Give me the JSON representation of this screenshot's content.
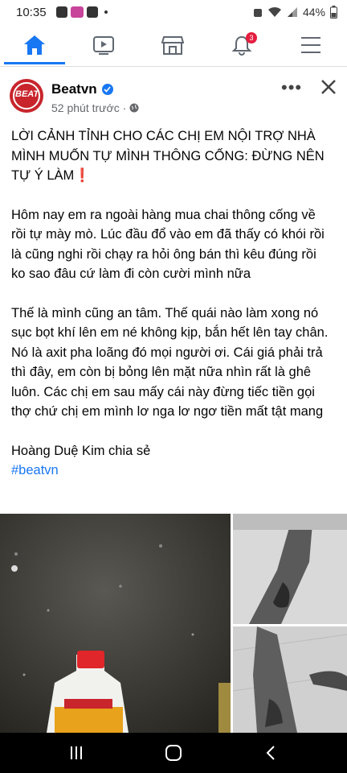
{
  "status_bar": {
    "time": "10:35",
    "battery": "44%"
  },
  "nav": {
    "tabs": [
      {
        "icon": "home-icon",
        "active": true
      },
      {
        "icon": "video-icon",
        "active": false
      },
      {
        "icon": "marketplace-icon",
        "active": false
      },
      {
        "icon": "notifications-icon",
        "active": false,
        "badge": "3"
      },
      {
        "icon": "menu-icon",
        "active": false
      }
    ],
    "accent": "#1877f2"
  },
  "post": {
    "page_name": "Beatvn",
    "avatar_text": "BEAT",
    "time": "52 phút trước ·",
    "title": "LỜI CẢNH TỈNH CHO CÁC CHỊ EM NỘI TRỢ NHÀ MÌNH MUỐN TỰ MÌNH THÔNG CỐNG: ĐỪNG NÊN TỰ Ý LÀM",
    "title_emoji": "❗",
    "paragraph1": "Hôm nay em ra ngoài hàng mua chai thông cống về rồi tự mày mò. Lúc đầu đổ vào em đã thấy có khói rồi là cũng nghi rồi chạy ra hỏi ông bán thì kêu đúng rồi ko sao đâu cứ làm đi còn cười mình nữa",
    "paragraph2": "Thế là mình cũng an tâm. Thế quái nào làm xong nó sục bọt khí lên em né không kịp, bắn hết lên tay chân. Nó là axit pha loãng đó mọi người ơi. Cái giá phải trả thì đây, em còn bị bỏng lên mặt nữa nhìn rất là ghê luôn. Các chị em sau mấy cái này đừng tiếc tiền gọi thợ chứ chị em mình lơ nga lơ ngơ tiền mất tật mang",
    "author_line": "Hoàng Duệ Kim chia sẻ",
    "hashtag": "#beatvn"
  }
}
